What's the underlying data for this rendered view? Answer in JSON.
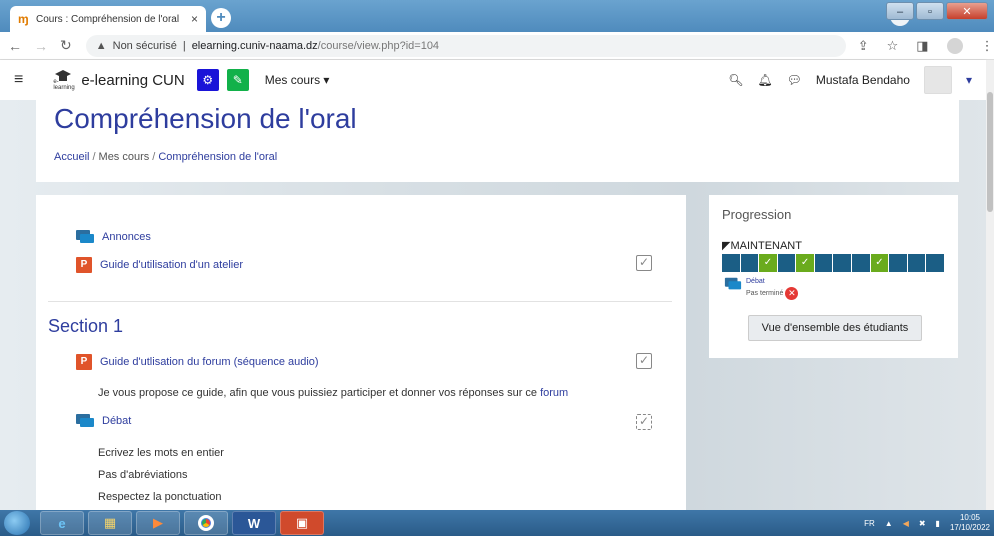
{
  "browser": {
    "tab_title": "Cours : Compréhension de l'oral",
    "tab_close": "×",
    "new_tab": "+",
    "url_warning": "Non sécurisé",
    "url_host": "elearning.cuniv-naama.dz",
    "url_path": "/course/view.php?id=104"
  },
  "navbar": {
    "brand": "e-learning CUN",
    "logo_text": "e-learning",
    "mes_cours": "Mes cours",
    "user_name": "Mustafa Bendaho"
  },
  "header": {
    "course_title": "Compréhension de l'oral",
    "breadcrumb": [
      "Accueil",
      "Mes cours",
      "Compréhension de l'oral"
    ]
  },
  "activities": {
    "annonces": "Annonces",
    "guide_atelier": "Guide d'utilisation d'un atelier",
    "section1_title": "Section 1",
    "guide_forum": "Guide d'utlisation du forum (séquence audio)",
    "guide_forum_desc_pre": "Je vous propose ce guide, afin que vous puissiez participer et donner vos réponses sur ce ",
    "guide_forum_desc_link": "forum",
    "debat": "Débat",
    "rules": [
      "Ecrivez les mots en entier",
      "Pas d'abréviations",
      "Respectez la ponctuation"
    ]
  },
  "progression": {
    "title": "Progression",
    "now_label": "MAINTENANT",
    "cells": [
      false,
      false,
      true,
      false,
      true,
      false,
      false,
      false,
      true,
      false,
      false,
      false
    ],
    "current_activity": "Débat",
    "current_status": "Pas terminé",
    "overview_button": "Vue d'ensemble des étudiants"
  },
  "taskbar": {
    "lang": "FR",
    "time": "10:05",
    "date": "17/10/2022"
  }
}
